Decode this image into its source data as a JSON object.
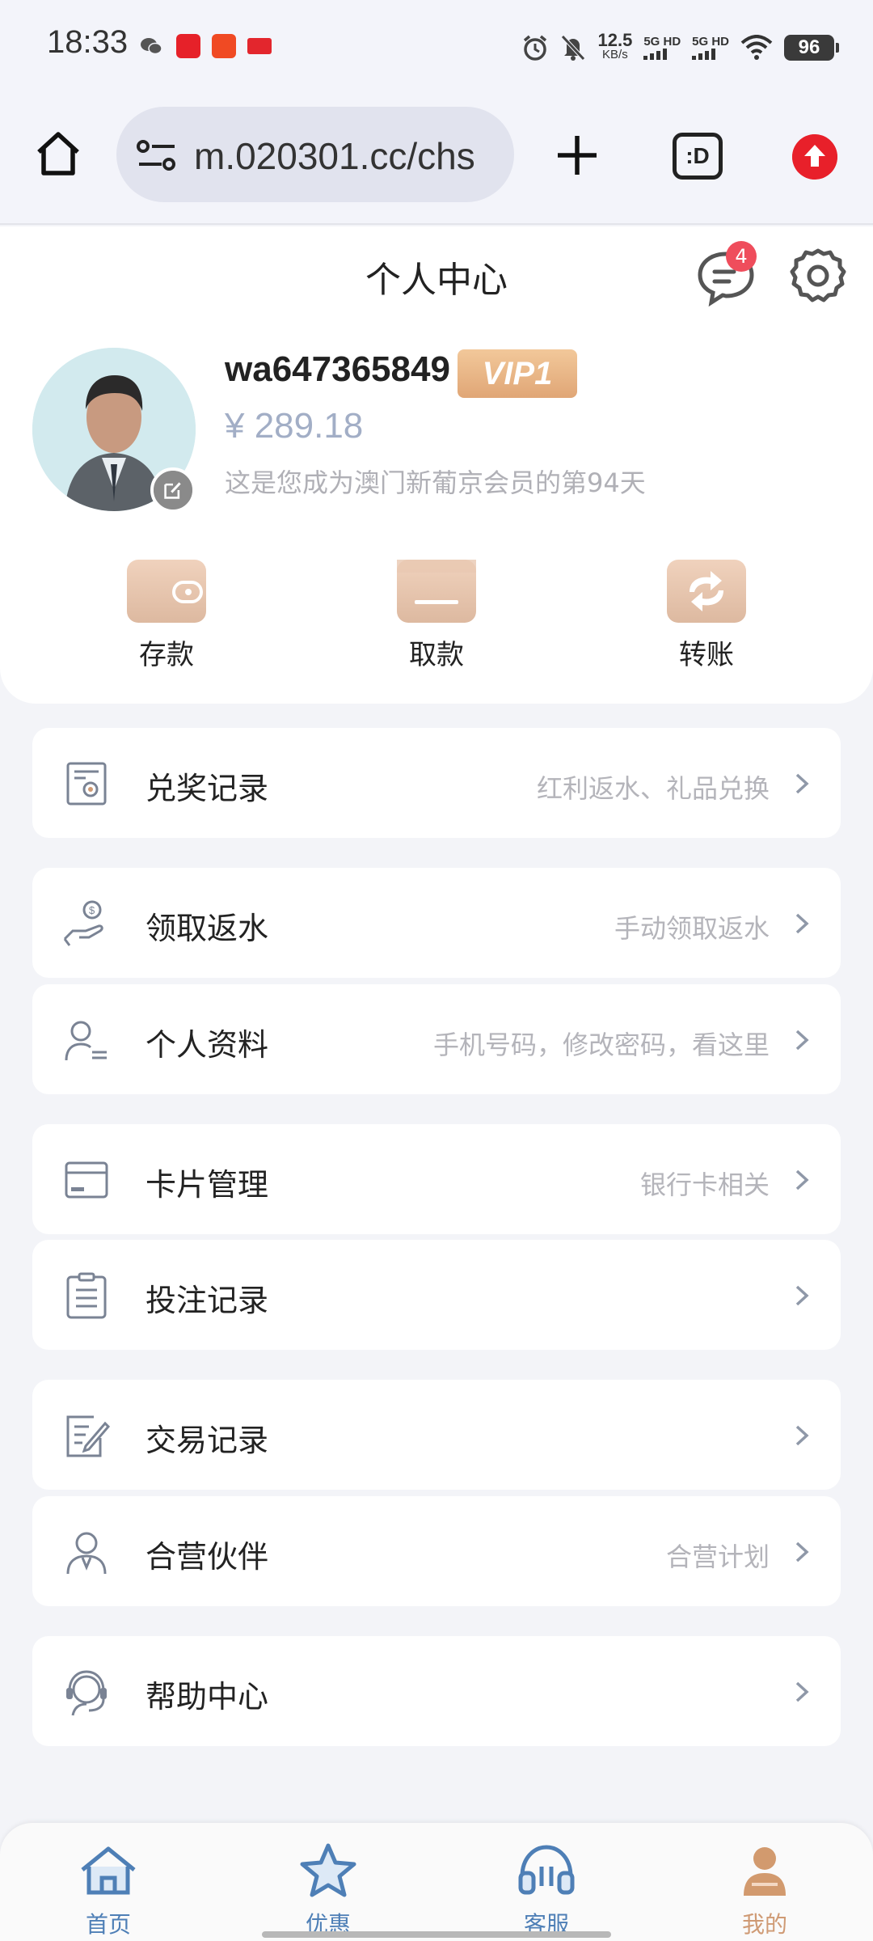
{
  "status_bar": {
    "time": "18:33",
    "net_speed_value": "12.5",
    "net_speed_unit": "KB/s",
    "network1": "5G HD",
    "network2": "5G HD",
    "battery": "96",
    "icons": [
      "wechat-icon",
      "app-icon-red",
      "app-icon-orange",
      "toutiao-icon",
      "alarm-icon",
      "mute-icon",
      "wifi-icon"
    ]
  },
  "browser": {
    "url": "m.020301.cc/chs",
    "tabs_label": ":D",
    "icons": [
      "home-icon",
      "tune-icon",
      "plus-icon",
      "tabs-icon",
      "upload-icon"
    ]
  },
  "header": {
    "title": "个人中心",
    "message_count": "4"
  },
  "profile": {
    "username": "wa647365849",
    "vip": "VIP1",
    "balance": "¥ 289.18",
    "member_days": "这是您成为澳门新葡京会员的第94天"
  },
  "quick_actions": [
    {
      "label": "存款",
      "icon": "wallet-icon"
    },
    {
      "label": "取款",
      "icon": "card-icon"
    },
    {
      "label": "转账",
      "icon": "transfer-icon"
    }
  ],
  "menu": [
    {
      "label": "兑奖记录",
      "hint": "红利返水、礼品兑换",
      "icon": "certificate-icon"
    },
    {
      "label": "领取返水",
      "hint": "手动领取返水",
      "icon": "hand-coin-icon"
    },
    {
      "label": "个人资料",
      "hint": "手机号码，修改密码，看这里",
      "icon": "user-profile-icon"
    },
    {
      "label": "卡片管理",
      "hint": "银行卡相关",
      "icon": "bank-card-icon"
    },
    {
      "label": "投注记录",
      "hint": "",
      "icon": "clipboard-icon"
    },
    {
      "label": "交易记录",
      "hint": "",
      "icon": "edit-document-icon"
    },
    {
      "label": "合营伙伴",
      "hint": "合营计划",
      "icon": "partner-icon"
    },
    {
      "label": "帮助中心",
      "hint": "",
      "icon": "headset-agent-icon"
    }
  ],
  "bottom_nav": [
    {
      "label": "首页",
      "icon": "home-nav-icon"
    },
    {
      "label": "优惠",
      "icon": "star-nav-icon"
    },
    {
      "label": "客服",
      "icon": "headphones-nav-icon"
    },
    {
      "label": "我的",
      "icon": "user-nav-icon"
    }
  ],
  "colors": {
    "accent_gold": "#dfa97c",
    "nav_blue": "#4e7fb6",
    "badge_red": "#ef4d5c",
    "balance_blue_grey": "#a2aec6",
    "page_bg": "#f3f4f8"
  }
}
